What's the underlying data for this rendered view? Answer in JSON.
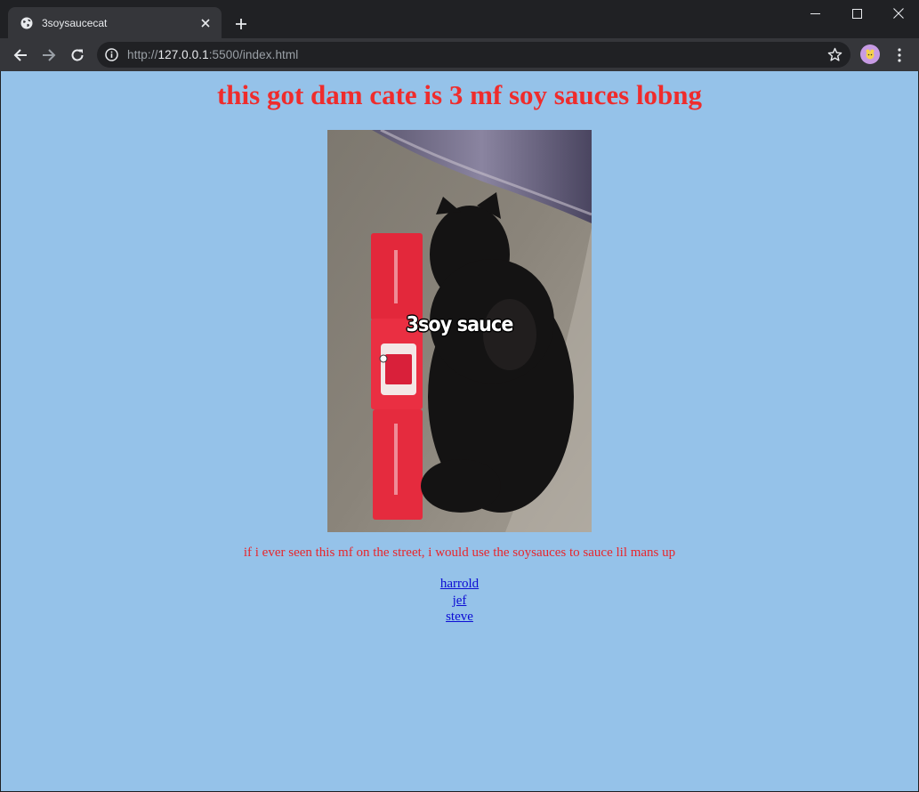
{
  "browser": {
    "tab_title": "3soysaucecat",
    "url_scheme": "http://",
    "url_host": "127.0.0.1",
    "url_rest": ":5500/index.html"
  },
  "page": {
    "headline": "this got dam cate is 3 mf soy sauces lobng",
    "image_overlay_text": "3soy sauce",
    "caption": "if i ever seen this mf on the street, i would use the soysauces to sauce lil mans up",
    "links": [
      "harrold",
      "jef",
      "steve"
    ],
    "colors": {
      "background": "#95c2e9",
      "headline": "#ef2c2c",
      "caption": "#e8262c",
      "link": "#0c0cd4"
    }
  }
}
